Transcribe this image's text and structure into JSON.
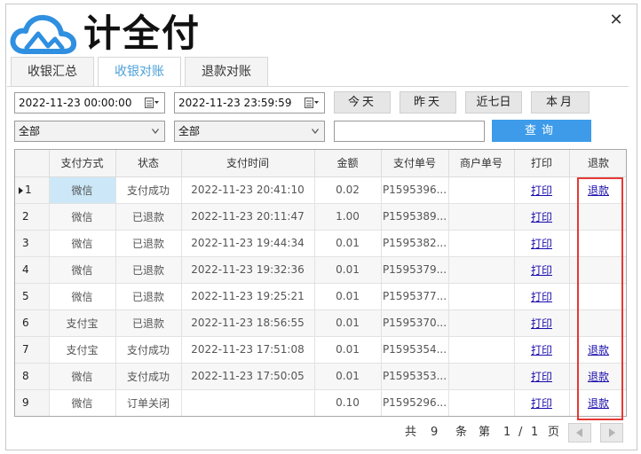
{
  "brand": {
    "name": "计全付"
  },
  "window": {
    "close_glyph": "✕"
  },
  "tabs": [
    {
      "label": "收银汇总",
      "active": false
    },
    {
      "label": "收银对账",
      "active": true
    },
    {
      "label": "退款对账",
      "active": false
    }
  ],
  "filters": {
    "start_datetime": "2022-11-23 00:00:00",
    "end_datetime": "2022-11-23 23:59:59",
    "select1": "全部",
    "select2": "全部",
    "search_value": "",
    "btn_today": "今天",
    "btn_yesterday": "昨天",
    "btn_last7": "近七日",
    "btn_month": "本月",
    "btn_query": "查询"
  },
  "table": {
    "columns": [
      "",
      "支付方式",
      "状态",
      "支付时间",
      "金额",
      "支付单号",
      "商户单号",
      "打印",
      "退款"
    ],
    "rows": [
      {
        "no": "1",
        "method": "微信",
        "status": "支付成功",
        "time": "2022-11-23 20:41:10",
        "amount": "0.02",
        "order": "P1595396...",
        "merchant": "",
        "print": "打印",
        "refund": "退款"
      },
      {
        "no": "2",
        "method": "微信",
        "status": "已退款",
        "time": "2022-11-23 20:11:47",
        "amount": "1.00",
        "order": "P1595389...",
        "merchant": "",
        "print": "打印",
        "refund": ""
      },
      {
        "no": "3",
        "method": "微信",
        "status": "已退款",
        "time": "2022-11-23 19:44:34",
        "amount": "0.01",
        "order": "P1595382...",
        "merchant": "",
        "print": "打印",
        "refund": ""
      },
      {
        "no": "4",
        "method": "微信",
        "status": "已退款",
        "time": "2022-11-23 19:32:36",
        "amount": "0.01",
        "order": "P1595379...",
        "merchant": "",
        "print": "打印",
        "refund": ""
      },
      {
        "no": "5",
        "method": "微信",
        "status": "已退款",
        "time": "2022-11-23 19:25:21",
        "amount": "0.01",
        "order": "P1595377...",
        "merchant": "",
        "print": "打印",
        "refund": ""
      },
      {
        "no": "6",
        "method": "支付宝",
        "status": "已退款",
        "time": "2022-11-23 18:56:55",
        "amount": "0.01",
        "order": "P1595370...",
        "merchant": "",
        "print": "打印",
        "refund": ""
      },
      {
        "no": "7",
        "method": "支付宝",
        "status": "支付成功",
        "time": "2022-11-23 17:51:08",
        "amount": "0.01",
        "order": "P1595354...",
        "merchant": "",
        "print": "打印",
        "refund": "退款"
      },
      {
        "no": "8",
        "method": "微信",
        "status": "支付成功",
        "time": "2022-11-23 17:50:05",
        "amount": "0.01",
        "order": "P1595353...",
        "merchant": "",
        "print": "打印",
        "refund": "退款"
      },
      {
        "no": "9",
        "method": "微信",
        "status": "订单关闭",
        "time": "",
        "amount": "0.10",
        "order": "P1595296...",
        "merchant": "",
        "print": "打印",
        "refund": "退款"
      }
    ]
  },
  "pager": {
    "total_prefix": "共",
    "total": "9",
    "total_suffix": "条",
    "page_prefix": "第",
    "page_current": "1",
    "page_sep": "/",
    "page_total": "1",
    "page_suffix": "页"
  },
  "colors": {
    "accent": "#3d9be9",
    "highlight": "#e53935",
    "link": "#1a0dab",
    "logo_blue": "#2f8fe0"
  }
}
